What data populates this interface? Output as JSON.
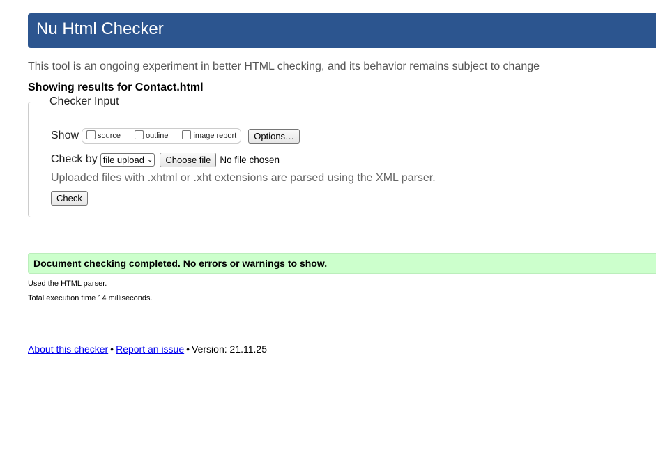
{
  "header": {
    "title": "Nu Html Checker"
  },
  "intro": {
    "text": "This tool is an ongoing experiment in better HTML checking, and its behavior remains subject to change"
  },
  "results": {
    "prefix": "Showing results for ",
    "filename": "Contact.html"
  },
  "checker_input": {
    "legend": "Checker Input",
    "show_label": "Show",
    "show_options": [
      {
        "label": "source",
        "checked": false
      },
      {
        "label": "outline",
        "checked": false
      },
      {
        "label": "image report",
        "checked": false
      }
    ],
    "options_button": "Options…",
    "check_by_label": "Check by",
    "check_by_selected": "file upload",
    "choose_file_button": "Choose file",
    "no_file_text": "No file chosen",
    "xml_note": "Uploaded files with .xhtml or .xht extensions are parsed using the XML parser.",
    "check_button": "Check"
  },
  "status": {
    "success_message": "Document checking completed. No errors or warnings to show.",
    "success_color": "#ccffcc",
    "parser_note": "Used the HTML parser.",
    "execution_time": "Total execution time 14 milliseconds."
  },
  "footer": {
    "about_link": "About this checker",
    "separator": "•",
    "report_link": "Report an issue",
    "version_text": "Version: 21.11.25"
  },
  "colors": {
    "header_bg": "#2c558f",
    "link": "#0000ee"
  }
}
